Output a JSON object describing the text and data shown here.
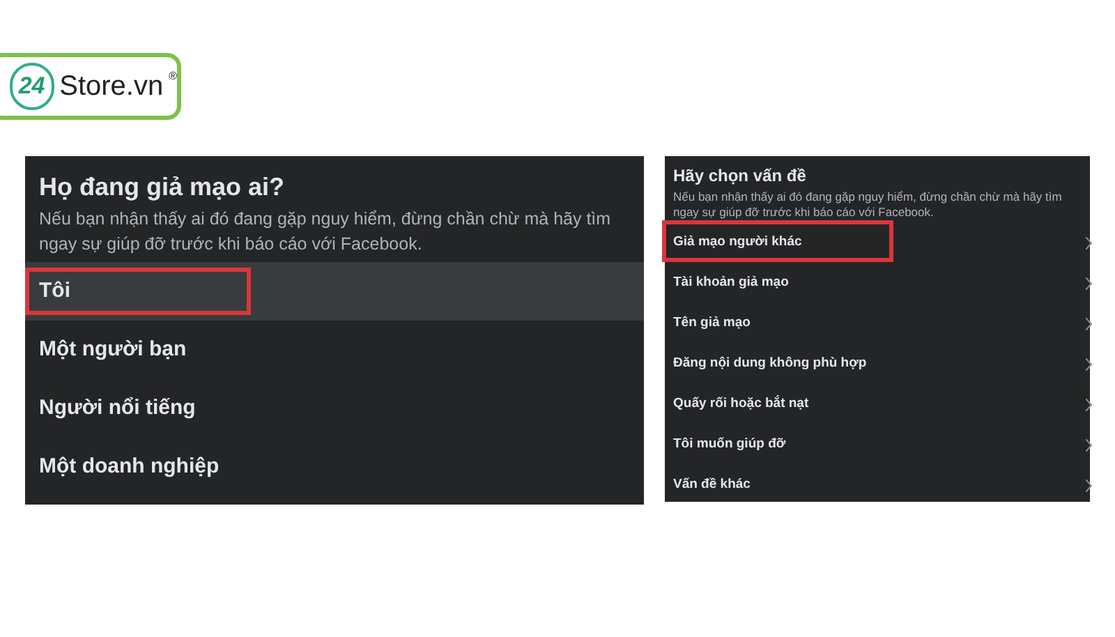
{
  "logo": {
    "number": "24",
    "name": "Store.vn",
    "mark": "®"
  },
  "panels": [
    {
      "title": "Họ đang giả mạo ai?",
      "description": "Nếu bạn nhận thấy ai đó đang gặp nguy hiểm, đừng chần chừ mà hãy tìm ngay sự giúp đỡ trước khi báo cáo với Facebook.",
      "kind": "large",
      "items": [
        {
          "label": "Tôi",
          "selected": true,
          "marked": true
        },
        {
          "label": "Một người bạn",
          "selected": false,
          "marked": false
        },
        {
          "label": "Người nổi tiếng",
          "selected": false,
          "marked": false
        },
        {
          "label": "Một doanh nghiệp",
          "selected": false,
          "marked": false
        }
      ]
    },
    {
      "title": "Hãy chọn vấn đề",
      "description": "Nếu bạn nhận thấy ai đó đang gặp nguy hiểm, đừng chần chừ mà hãy tìm ngay sự giúp đỡ trước khi báo cáo với Facebook.",
      "kind": "small",
      "items": [
        {
          "label": "Giả mạo người khác",
          "selected": false,
          "marked": true
        },
        {
          "label": "Tài khoản giả mạo",
          "selected": false,
          "marked": false
        },
        {
          "label": "Tên giả mạo",
          "selected": false,
          "marked": false
        },
        {
          "label": "Đăng nội dung không phù hợp",
          "selected": false,
          "marked": false
        },
        {
          "label": "Quấy rối hoặc bắt nạt",
          "selected": false,
          "marked": false
        },
        {
          "label": "Tôi muốn giúp đỡ",
          "selected": false,
          "marked": false
        },
        {
          "label": "Vấn đề khác",
          "selected": false,
          "marked": false
        }
      ]
    }
  ]
}
